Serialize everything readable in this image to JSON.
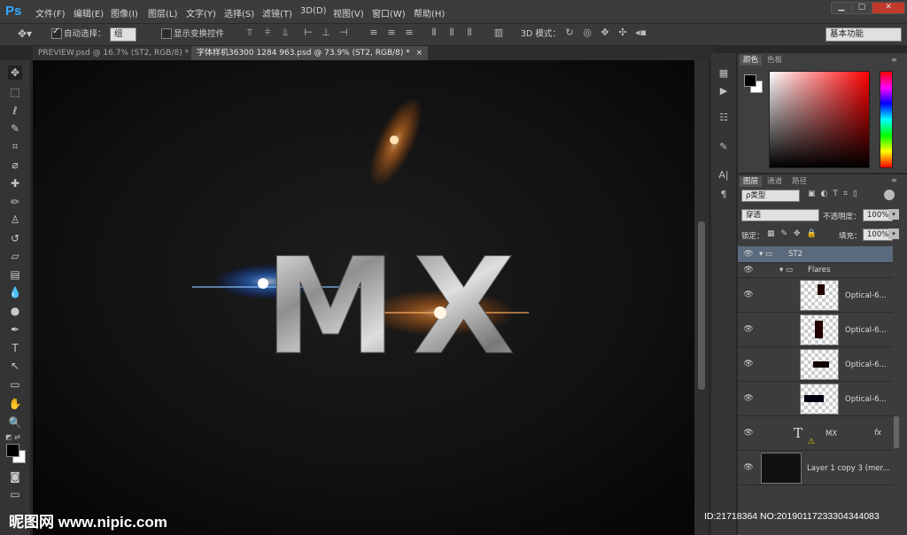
{
  "app": {
    "logo": "Ps"
  },
  "menus": [
    "文件(F)",
    "编辑(E)",
    "图像(I)",
    "图层(L)",
    "文字(Y)",
    "选择(S)",
    "滤镜(T)",
    "3D(D)",
    "视图(V)",
    "窗口(W)",
    "帮助(H)"
  ],
  "window_buttons": {
    "minimize": "▁",
    "restore": "▢",
    "close": "✕"
  },
  "options": {
    "auto_select_label": "自动选择：",
    "auto_select_value": "组",
    "show_transform_label": "显示变换控件",
    "mode_3d_label": "3D 模式：",
    "workspace_value": "基本功能"
  },
  "tabs": [
    {
      "label": "PREVIEW.psd @ 16.7% (ST2, RGB/8) *",
      "close": "×"
    },
    {
      "label": "字体样机36300 1284 963.psd @ 73.9% (ST2, RGB/8) *",
      "close": "×"
    }
  ],
  "canvas": {
    "text": "MX"
  },
  "color_panel": {
    "tabs": [
      "颜色",
      "色板"
    ]
  },
  "layers_panel": {
    "tabs": [
      "图层",
      "通道",
      "路径"
    ],
    "filter_label": "ρ类型",
    "blend_mode": "穿透",
    "opacity_label": "不透明度：",
    "opacity_value": "100%",
    "lock_label": "锁定：",
    "fill_label": "填充：",
    "fill_value": "100%",
    "layers": [
      {
        "name": "ST2",
        "type": "group"
      },
      {
        "name": "Flares",
        "type": "group"
      },
      {
        "name": "Optical-6...",
        "type": "image"
      },
      {
        "name": "Optical-6...",
        "type": "image"
      },
      {
        "name": "Optical-6...",
        "type": "image"
      },
      {
        "name": "Optical-6...",
        "type": "image"
      },
      {
        "name": "MX",
        "type": "text",
        "fx": "fx"
      },
      {
        "name": "Layer 1 copy 3 (mer...",
        "type": "image"
      }
    ]
  },
  "watermark": {
    "left": "昵图网 www.nipic.com",
    "right": "ID:21718364 NO:20190117233304344083"
  },
  "colors": {
    "accent": "#31a8ff",
    "selected_layer": "#5b6a7c",
    "panel_bg": "#3c3c3c"
  }
}
